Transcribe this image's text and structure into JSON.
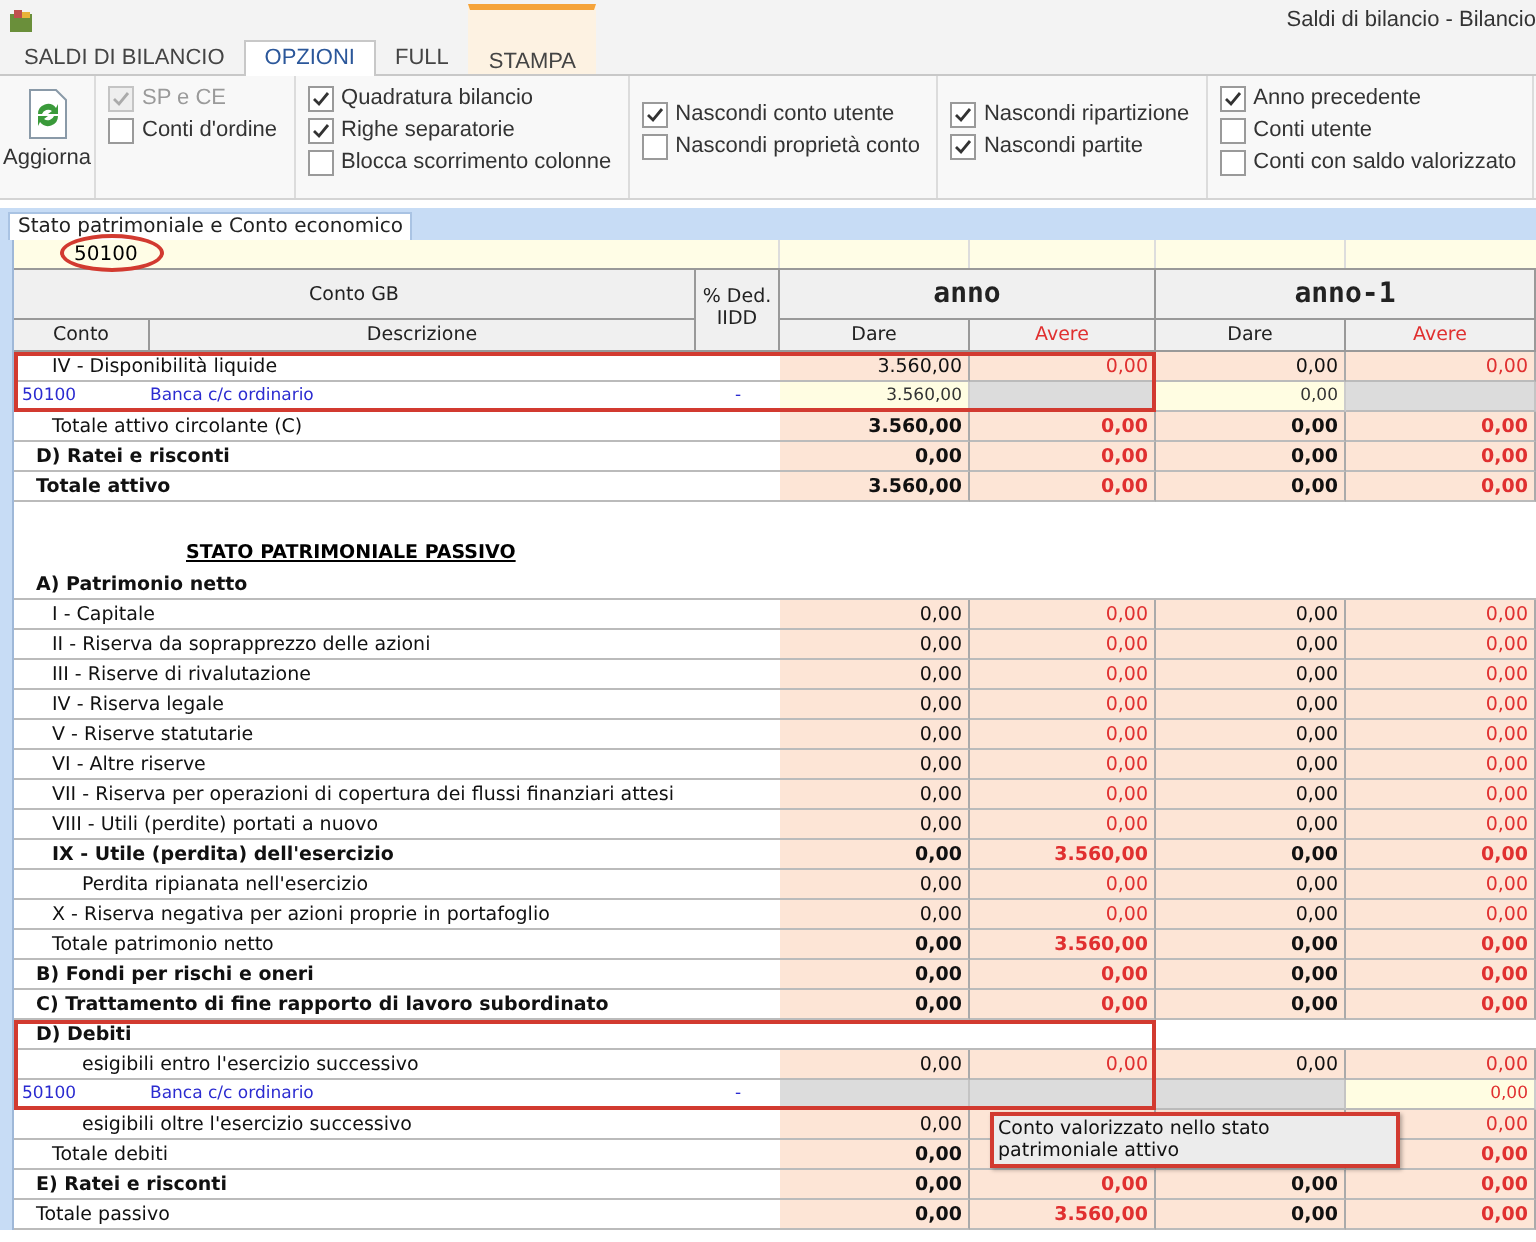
{
  "window": {
    "title": "Saldi di bilancio - Bilancio"
  },
  "ribbon_tabs": [
    {
      "label": "SALDI DI BILANCIO",
      "selected": false,
      "contextual": false
    },
    {
      "label": "OPZIONI",
      "selected": true,
      "contextual": false
    },
    {
      "label": "FULL",
      "selected": false,
      "contextual": false
    },
    {
      "label": "STAMPA",
      "selected": false,
      "contextual": true
    }
  ],
  "refresh_button": {
    "label": "Aggiorna"
  },
  "option_groups": [
    [
      {
        "label": "SP e CE",
        "checked": true,
        "disabled": true
      },
      {
        "label": "Conti d'ordine",
        "checked": false,
        "disabled": false
      }
    ],
    [
      {
        "label": "Quadratura bilancio",
        "checked": true,
        "disabled": false
      },
      {
        "label": "Righe separatorie",
        "checked": true,
        "disabled": false
      },
      {
        "label": "Blocca scorrimento colonne",
        "checked": false,
        "disabled": false
      }
    ],
    [
      {
        "label": "Nascondi conto utente",
        "checked": true,
        "disabled": false
      },
      {
        "label": "Nascondi proprietà conto",
        "checked": false,
        "disabled": false
      }
    ],
    [
      {
        "label": "Nascondi ripartizione",
        "checked": true,
        "disabled": false
      },
      {
        "label": "Nascondi partite",
        "checked": true,
        "disabled": false
      }
    ],
    [
      {
        "label": "Anno precedente",
        "checked": true,
        "disabled": false
      },
      {
        "label": "Conti utente",
        "checked": false,
        "disabled": false
      },
      {
        "label": "Conti con saldo valorizzato",
        "checked": false,
        "disabled": false
      }
    ]
  ],
  "document_tabs": [
    {
      "label": "Stato patrimoniale e Conto economico",
      "selected": true
    }
  ],
  "filter": {
    "conto": "50100",
    "circled": true
  },
  "table": {
    "group_header": "Conto GB",
    "deduction_header": "% Ded. IIDD",
    "periods": [
      "anno",
      "anno-1"
    ],
    "columns": [
      "Conto",
      "Descrizione",
      "Dare",
      "Avere",
      "Dare",
      "Avere"
    ],
    "rows": [
      {
        "kind": "frame",
        "rows": [
          {
            "kind": "item",
            "label": "IV - Disponibilità liquide",
            "values": {
              "dare": "3.560,00",
              "avere": "0,00",
              "dare_prev": "0,00",
              "avere_prev": "0,00"
            }
          },
          {
            "kind": "account",
            "conto": "50100",
            "label": "Banca c/c ordinario",
            "deduction": "-",
            "cells": [
              {
                "kind": "input",
                "text": "3.560,00"
              },
              {
                "kind": "locked"
              },
              {
                "kind": "input",
                "text": "0,00"
              },
              {
                "kind": "locked"
              }
            ]
          }
        ]
      },
      {
        "kind": "total",
        "label": "Totale attivo circolante (C)",
        "values": {
          "dare": "3.560,00",
          "avere": "0,00",
          "dare_prev": "0,00",
          "avere_prev": "0,00"
        }
      },
      {
        "kind": "section",
        "label": "D) Ratei e risconti",
        "values": {
          "dare": "0,00",
          "avere": "0,00",
          "dare_prev": "0,00",
          "avere_prev": "0,00"
        }
      },
      {
        "kind": "grand",
        "label": "Totale attivo",
        "values": {
          "dare": "3.560,00",
          "avere": "0,00",
          "dare_prev": "0,00",
          "avere_prev": "0,00"
        }
      },
      {
        "kind": "blank"
      },
      {
        "kind": "heading",
        "label": "STATO PATRIMONIALE PASSIVO"
      },
      {
        "kind": "section",
        "label": "A) Patrimonio netto"
      },
      {
        "kind": "item",
        "label": "I - Capitale",
        "values": {
          "dare": "0,00",
          "avere": "0,00",
          "dare_prev": "0,00",
          "avere_prev": "0,00"
        }
      },
      {
        "kind": "item",
        "label": "II - Riserva da soprapprezzo delle azioni",
        "values": {
          "dare": "0,00",
          "avere": "0,00",
          "dare_prev": "0,00",
          "avere_prev": "0,00"
        }
      },
      {
        "kind": "item",
        "label": "III - Riserve di rivalutazione",
        "values": {
          "dare": "0,00",
          "avere": "0,00",
          "dare_prev": "0,00",
          "avere_prev": "0,00"
        }
      },
      {
        "kind": "item",
        "label": "IV - Riserva legale",
        "values": {
          "dare": "0,00",
          "avere": "0,00",
          "dare_prev": "0,00",
          "avere_prev": "0,00"
        }
      },
      {
        "kind": "item",
        "label": "V - Riserve statutarie",
        "values": {
          "dare": "0,00",
          "avere": "0,00",
          "dare_prev": "0,00",
          "avere_prev": "0,00"
        }
      },
      {
        "kind": "item",
        "label": "VI - Altre riserve",
        "values": {
          "dare": "0,00",
          "avere": "0,00",
          "dare_prev": "0,00",
          "avere_prev": "0,00"
        }
      },
      {
        "kind": "item",
        "label": "VII - Riserva per operazioni di copertura dei flussi finanziari attesi",
        "values": {
          "dare": "0,00",
          "avere": "0,00",
          "dare_prev": "0,00",
          "avere_prev": "0,00"
        }
      },
      {
        "kind": "item",
        "label": "VIII - Utili (perdite) portati a nuovo",
        "values": {
          "dare": "0,00",
          "avere": "0,00",
          "dare_prev": "0,00",
          "avere_prev": "0,00"
        }
      },
      {
        "kind": "result",
        "label": "IX - Utile (perdita) dell'esercizio",
        "values": {
          "dare": "0,00",
          "avere": "3.560,00",
          "dare_prev": "0,00",
          "avere_prev": "0,00"
        }
      },
      {
        "kind": "subitem",
        "label": "Perdita ripianata nell'esercizio",
        "values": {
          "dare": "0,00",
          "avere": "0,00",
          "dare_prev": "0,00",
          "avere_prev": "0,00"
        }
      },
      {
        "kind": "item",
        "label": "X - Riserva negativa per azioni proprie in portafoglio",
        "values": {
          "dare": "0,00",
          "avere": "0,00",
          "dare_prev": "0,00",
          "avere_prev": "0,00"
        }
      },
      {
        "kind": "total",
        "label": "Totale patrimonio netto",
        "values": {
          "dare": "0,00",
          "avere": "3.560,00",
          "dare_prev": "0,00",
          "avere_prev": "0,00"
        }
      },
      {
        "kind": "section",
        "label": "B) Fondi per rischi e oneri",
        "values": {
          "dare": "0,00",
          "avere": "0,00",
          "dare_prev": "0,00",
          "avere_prev": "0,00"
        }
      },
      {
        "kind": "section",
        "label": "C) Trattamento di fine rapporto di lavoro subordinato",
        "values": {
          "dare": "0,00",
          "avere": "0,00",
          "dare_prev": "0,00",
          "avere_prev": "0,00"
        }
      },
      {
        "kind": "frame",
        "rows": [
          {
            "kind": "section",
            "label": "D) Debiti"
          },
          {
            "kind": "subitem",
            "label": "esigibili entro l'esercizio successivo",
            "values": {
              "dare": "0,00",
              "avere": "0,00",
              "dare_prev": "0,00",
              "avere_prev": "0,00"
            }
          },
          {
            "kind": "account",
            "conto": "50100",
            "label": "Banca c/c ordinario",
            "deduction": "-",
            "cells": [
              {
                "kind": "locked"
              },
              {
                "kind": "locked"
              },
              {
                "kind": "locked"
              },
              {
                "kind": "input",
                "text": "0,00"
              }
            ]
          }
        ]
      },
      {
        "kind": "subitem",
        "label": "esigibili oltre l'esercizio successivo",
        "values": {
          "dare": "0,00",
          "avere_prev": "0,00"
        }
      },
      {
        "kind": "total",
        "label": "Totale debiti",
        "values": {
          "dare": "0,00",
          "avere_prev": "0,00"
        }
      },
      {
        "kind": "section",
        "label": "E) Ratei e risconti",
        "values": {
          "dare": "0,00",
          "avere": "0,00",
          "dare_prev": "0,00",
          "avere_prev": "0,00"
        }
      },
      {
        "kind": "final",
        "label": "Totale passivo",
        "values": {
          "dare": "0,00",
          "avere": "3.560,00",
          "dare_prev": "0,00",
          "avere_prev": "0,00"
        }
      }
    ]
  },
  "tooltip": {
    "text": "Conto valorizzato nello stato patrimoniale attivo"
  }
}
